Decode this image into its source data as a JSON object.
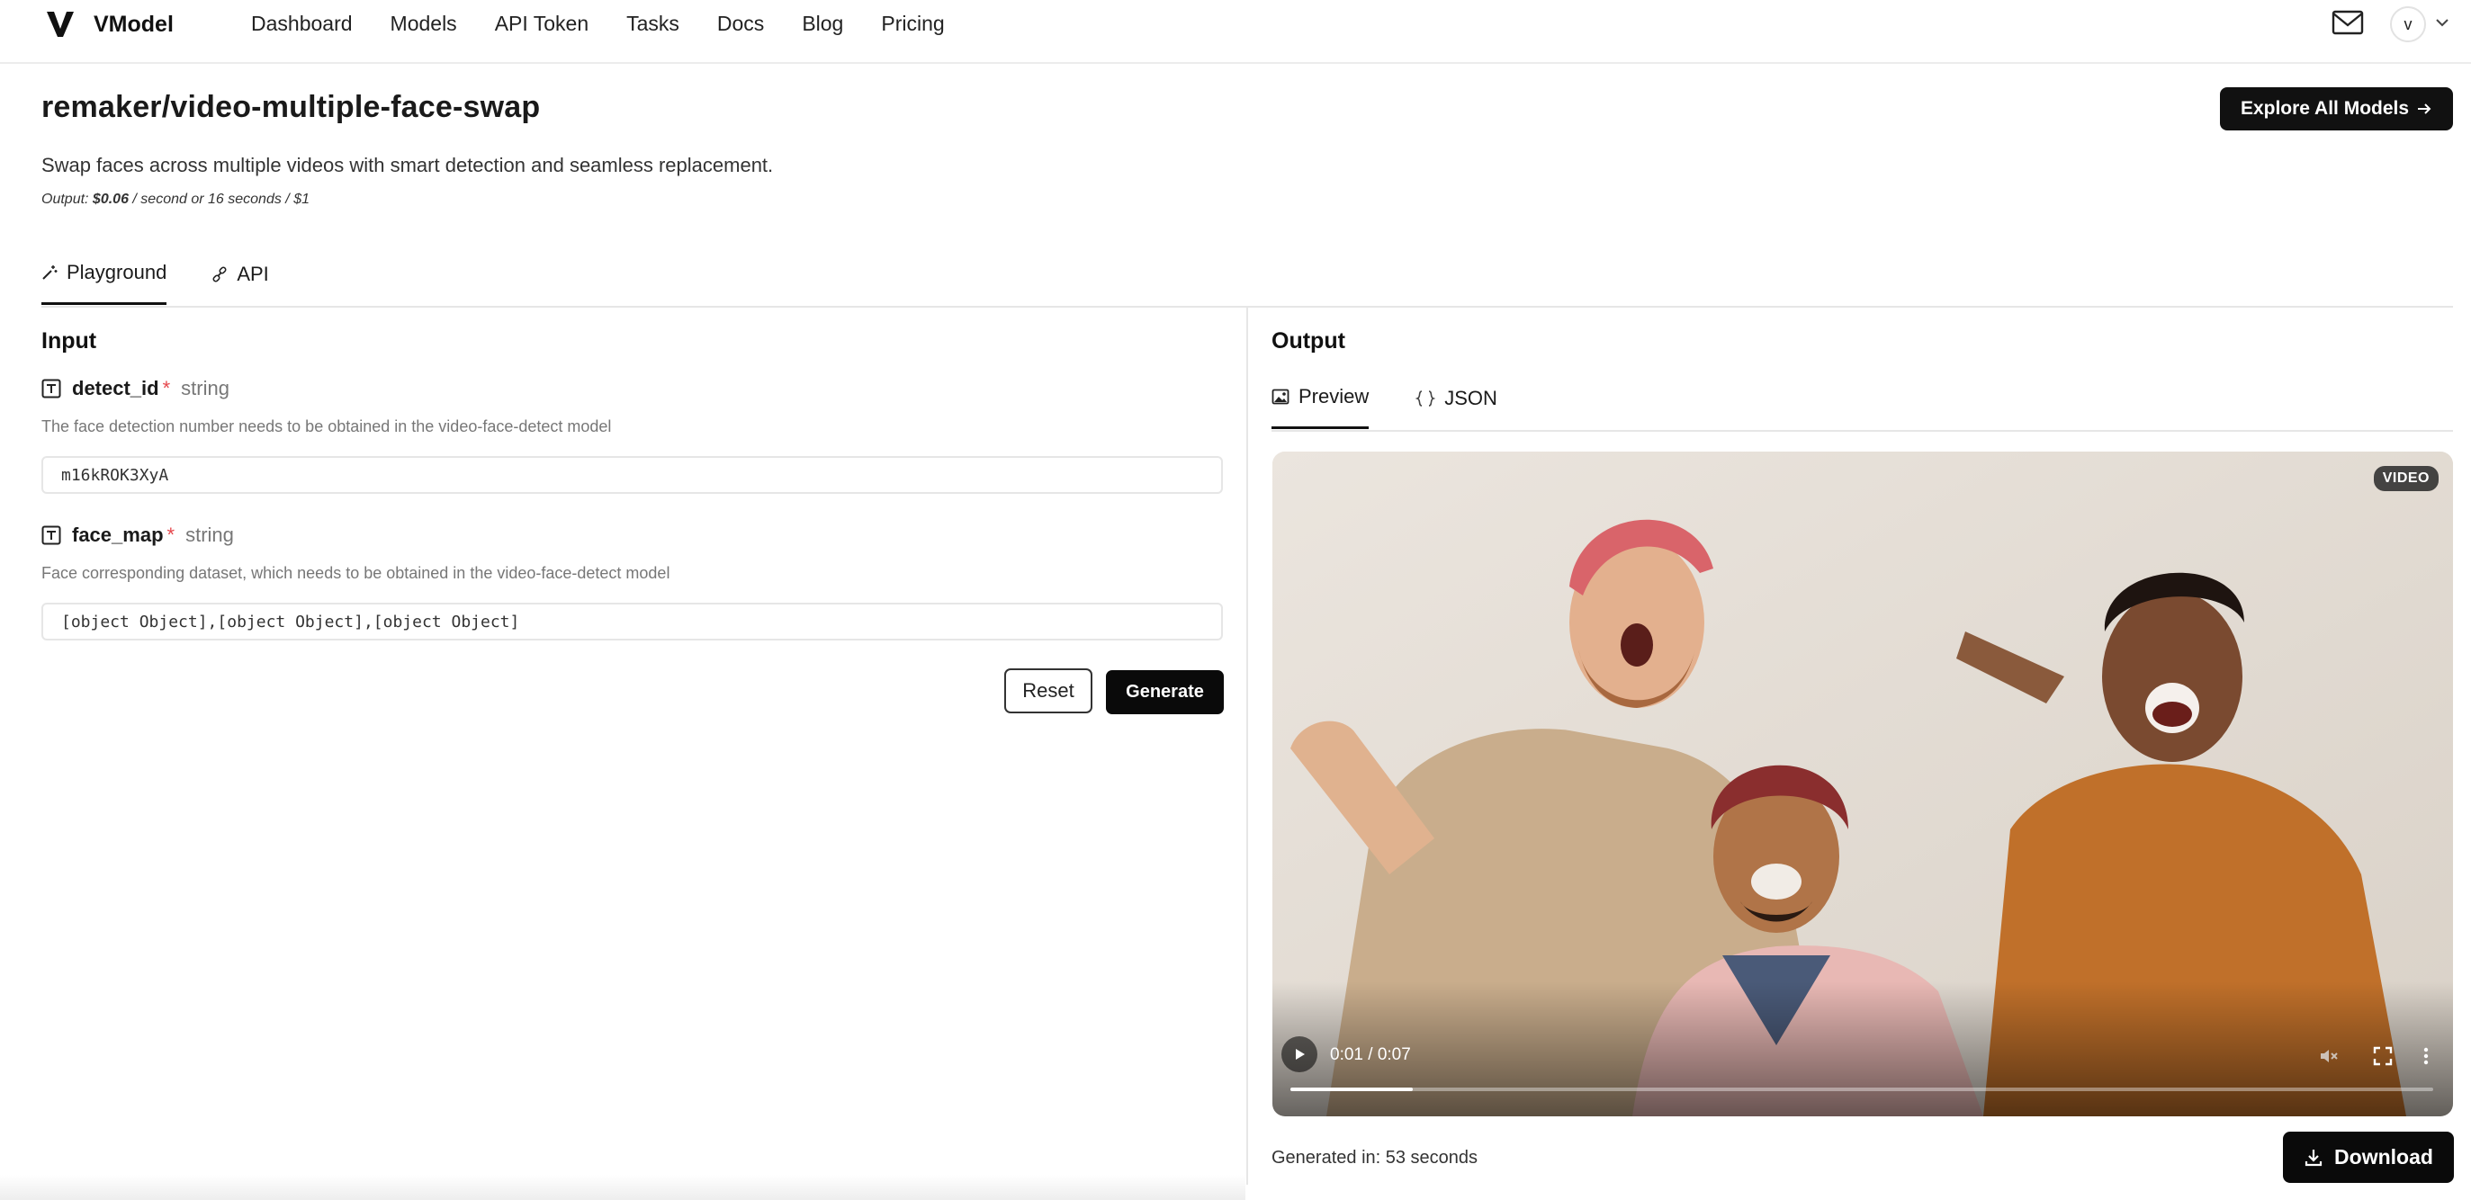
{
  "brand": {
    "name": "VModel"
  },
  "nav": {
    "links": [
      "Dashboard",
      "Models",
      "API Token",
      "Tasks",
      "Docs",
      "Blog",
      "Pricing"
    ],
    "avatar_initial": "v"
  },
  "header": {
    "title": "remaker/video-multiple-face-swap",
    "explore_label": "Explore All Models",
    "description": "Swap faces across multiple videos with smart detection and seamless replacement.",
    "pricing_prefix": "Output: ",
    "pricing_price": "$0.06",
    "pricing_suffix": " / second or 16 seconds / $1"
  },
  "tabs": [
    {
      "label": "Playground",
      "icon": "wand-icon",
      "active": true
    },
    {
      "label": "API",
      "icon": "link-icon",
      "active": false
    }
  ],
  "input": {
    "title": "Input",
    "fields": [
      {
        "name": "detect_id",
        "required_mark": "*",
        "type": "string",
        "help": "The face detection number needs to be obtained in the video-face-detect model",
        "value": "m16kROK3XyA"
      },
      {
        "name": "face_map",
        "required_mark": "*",
        "type": "string",
        "help": "Face corresponding dataset, which needs to be obtained in the video-face-detect model",
        "value": "[object Object],[object Object],[object Object]"
      }
    ],
    "reset_label": "Reset",
    "generate_label": "Generate"
  },
  "output": {
    "title": "Output",
    "tabs": [
      {
        "label": "Preview",
        "icon": "image-icon",
        "active": true
      },
      {
        "label": "JSON",
        "icon": "braces-icon",
        "active": false
      }
    ],
    "video_badge": "VIDEO",
    "time_display": "0:01 / 0:07",
    "progress_fraction": 0.107,
    "generated_text": "Generated in: 53 seconds",
    "download_label": "Download"
  },
  "colors": {
    "primary": "#0a0a0a",
    "required": "#e5484d",
    "muted": "#777777"
  }
}
